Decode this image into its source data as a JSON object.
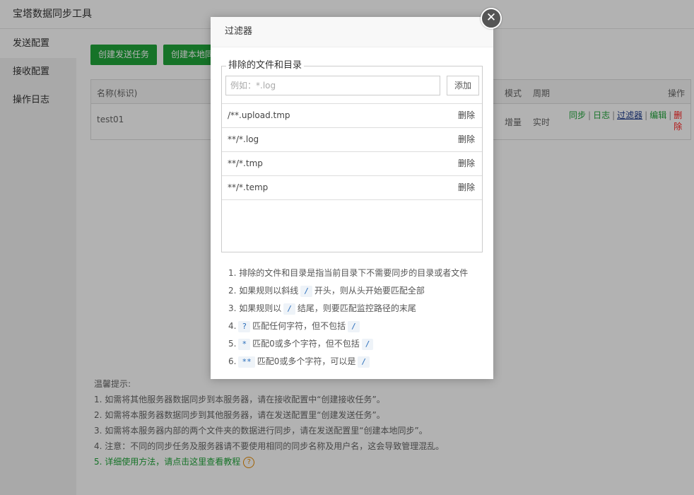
{
  "app": {
    "title": "宝塔数据同步工具"
  },
  "sidebar": {
    "items": [
      {
        "label": "发送配置"
      },
      {
        "label": "接收配置"
      },
      {
        "label": "操作日志"
      }
    ]
  },
  "toolbar": {
    "create_send": "创建发送任务",
    "create_local": "创建本地同步"
  },
  "table": {
    "headers": {
      "name": "名称(标识)",
      "mode": "模式",
      "period": "周期",
      "ops": "操作"
    },
    "row": {
      "name": "test01",
      "mode": "增量",
      "period": "实时",
      "ops": {
        "sync": "同步",
        "log": "日志",
        "filter": "过滤器",
        "edit": "编辑",
        "delete": "删除"
      }
    }
  },
  "tips": {
    "title": "温馨提示:",
    "lines": [
      "1. 如需将其他服务器数据同步到本服务器，请在接收配置中“创建接收任务”。",
      "2. 如需将本服务器数据同步到其他服务器，请在发送配置里“创建发送任务”。",
      "3. 如需将本服务器内部的两个文件夹的数据进行同步，请在发送配置里“创建本地同步”。",
      "4. 注意：不同的同步任务及服务器请不要使用相同的同步名称及用户名，这会导致管理混乱。"
    ],
    "help_link": "5. 详细使用方法，请点击这里查看教程",
    "help_icon": "?"
  },
  "modal": {
    "title": "过滤器",
    "close_glyph": "✕",
    "legend": "排除的文件和目录",
    "input": {
      "placeholder": "例如：*.log",
      "value": ""
    },
    "add_label": "添加",
    "rules": [
      {
        "pattern": "/**.upload.tmp",
        "delete": "删除"
      },
      {
        "pattern": "**/*.log",
        "delete": "删除"
      },
      {
        "pattern": "**/*.tmp",
        "delete": "删除"
      },
      {
        "pattern": "**/*.temp",
        "delete": "删除"
      }
    ],
    "notes": {
      "n1": "1. 排除的文件和目录是指当前目录下不需要同步的目录或者文件",
      "n2": {
        "pre": "2. 如果规则以斜线",
        "code": "/",
        "post": "开头，则从头开始要匹配全部"
      },
      "n3": {
        "pre": "3. 如果规则以",
        "code": "/",
        "post": "结尾，则要匹配监控路径的末尾"
      },
      "n4": {
        "pre": "4.",
        "code": "?",
        "mid": "匹配任何字符，但不包括",
        "code2": "/"
      },
      "n5": {
        "pre": "5.",
        "code": "*",
        "mid": "匹配0或多个字符，但不包括",
        "code2": "/"
      },
      "n6": {
        "pre": "6.",
        "code": "**",
        "mid": "匹配0或多个字符，可以是",
        "code2": "/"
      }
    }
  },
  "colors": {
    "accent": "#20a53a",
    "danger": "#ff1c1c",
    "link": "#1d3b8c",
    "warn": "#e68a00"
  }
}
